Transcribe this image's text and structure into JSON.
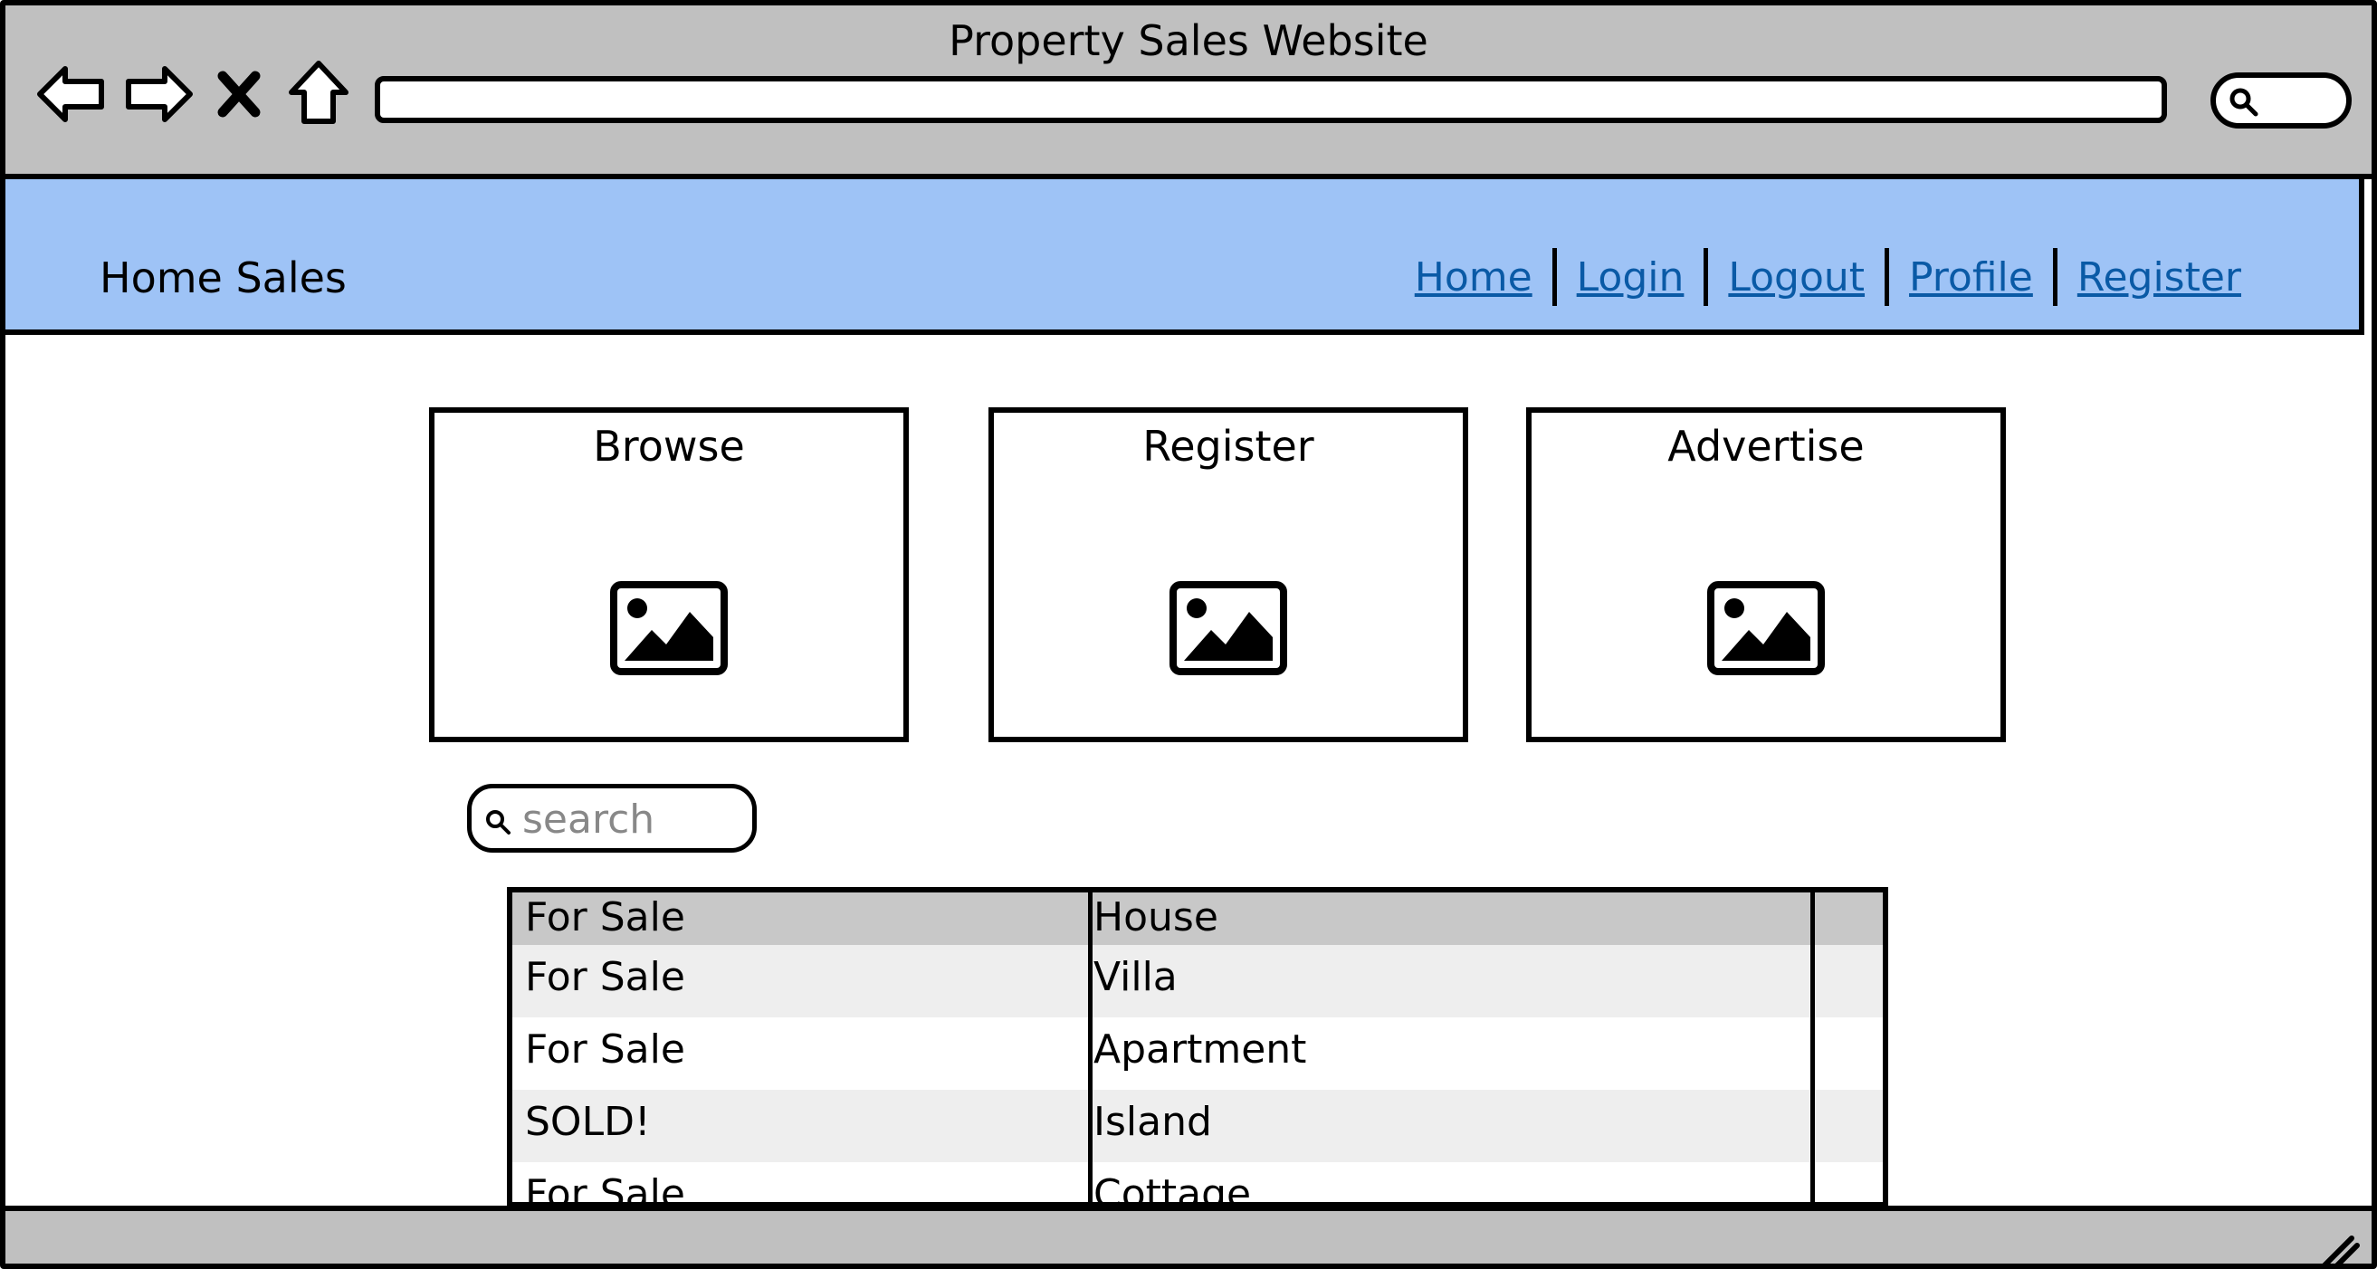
{
  "window": {
    "title": "Property Sales Website"
  },
  "toolbar": {
    "back_icon": "back-arrow-icon",
    "forward_icon": "forward-arrow-icon",
    "stop_icon": "stop-x-icon",
    "home_icon": "home-icon",
    "url": "",
    "search_icon": "search-icon"
  },
  "header": {
    "brand": "Home Sales",
    "nav": [
      "Home",
      "Login",
      "Logout",
      "Profile",
      "Register"
    ],
    "background": "#9ec3f6",
    "link_color": "#0a5aa6"
  },
  "cards": [
    {
      "title": "Browse",
      "icon": "image-placeholder-icon"
    },
    {
      "title": "Register",
      "icon": "image-placeholder-icon"
    },
    {
      "title": "Advertise",
      "icon": "image-placeholder-icon"
    }
  ],
  "search": {
    "placeholder": "search"
  },
  "table": {
    "header": [
      "For Sale",
      "House"
    ],
    "rows": [
      [
        "For Sale",
        "Villa"
      ],
      [
        "For Sale",
        "Apartment"
      ],
      [
        "SOLD!",
        "Island"
      ],
      [
        "For Sale",
        "Cottage"
      ]
    ],
    "stripe_color": "#eeeeee",
    "header_color": "#c8c8c8"
  },
  "statusbar": {
    "resize_icon": "resize-grip-icon"
  }
}
